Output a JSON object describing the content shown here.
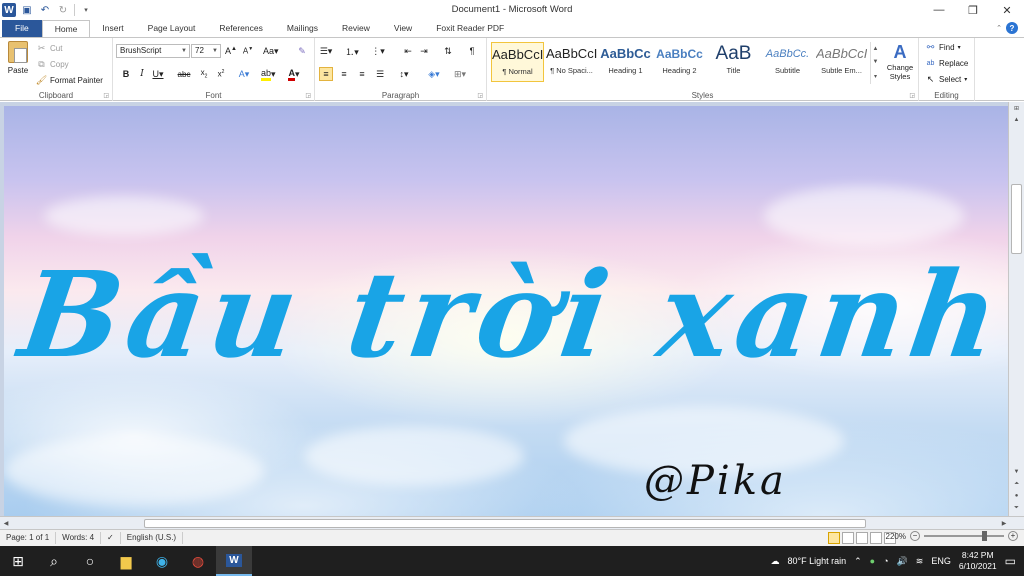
{
  "window": {
    "title": "Document1  -  Microsoft Word"
  },
  "tabs": [
    {
      "label": "File"
    },
    {
      "label": "Home"
    },
    {
      "label": "Insert"
    },
    {
      "label": "Page Layout"
    },
    {
      "label": "References"
    },
    {
      "label": "Mailings"
    },
    {
      "label": "Review"
    },
    {
      "label": "View"
    },
    {
      "label": "Foxit Reader PDF"
    }
  ],
  "ribbon": {
    "clipboard": {
      "label": "Clipboard",
      "paste": "Paste",
      "cut": "Cut",
      "copy": "Copy",
      "format_painter": "Format Painter"
    },
    "font": {
      "label": "Font",
      "font_name": "BrushScript",
      "font_size": "72"
    },
    "paragraph": {
      "label": "Paragraph"
    },
    "styles": {
      "label": "Styles",
      "items": [
        {
          "preview": "AaBbCcI",
          "name": "¶ Normal"
        },
        {
          "preview": "AaBbCcI",
          "name": "¶ No Spaci..."
        },
        {
          "preview": "AaBbCc",
          "name": "Heading 1"
        },
        {
          "preview": "AaBbCc",
          "name": "Heading 2"
        },
        {
          "preview": "AaB",
          "name": "Title"
        },
        {
          "preview": "AaBbCc.",
          "name": "Subtitle"
        },
        {
          "preview": "AaBbCcI",
          "name": "Subtle Em..."
        }
      ],
      "change_styles": "Change Styles"
    },
    "editing": {
      "label": "Editing",
      "find": "Find",
      "replace": "Replace",
      "select": "Select"
    }
  },
  "document": {
    "heading": "Bầu trời xanh",
    "signature": "@Pika"
  },
  "status": {
    "page": "Page: 1 of 1",
    "words": "Words: 4",
    "language": "English (U.S.)",
    "zoom": "220%"
  },
  "taskbar": {
    "weather": "80°F  Light rain",
    "lang": "ENG",
    "time": "8:42 PM",
    "date": "6/10/2021"
  },
  "colors": {
    "accent": "#2b579a",
    "heading_text": "#19a4e6"
  }
}
